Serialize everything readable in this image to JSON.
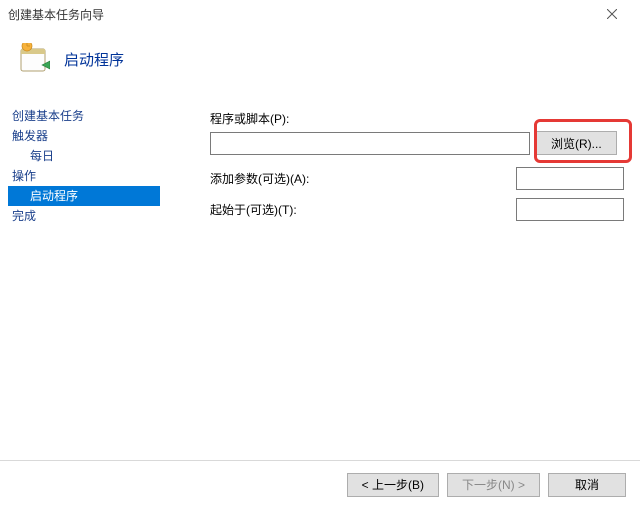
{
  "window": {
    "title": "创建基本任务向导"
  },
  "header": {
    "title": "启动程序"
  },
  "sidebar": {
    "items": [
      {
        "label": "创建基本任务",
        "sub": false,
        "selected": false
      },
      {
        "label": "触发器",
        "sub": false,
        "selected": false
      },
      {
        "label": "每日",
        "sub": true,
        "selected": false
      },
      {
        "label": "操作",
        "sub": false,
        "selected": false
      },
      {
        "label": "启动程序",
        "sub": true,
        "selected": true
      },
      {
        "label": "完成",
        "sub": false,
        "selected": false
      }
    ]
  },
  "form": {
    "script_label": "程序或脚本(P):",
    "script_value": "",
    "browse_label": "浏览(R)...",
    "args_label": "添加参数(可选)(A):",
    "args_value": "",
    "startin_label": "起始于(可选)(T):",
    "startin_value": ""
  },
  "footer": {
    "back": "< 上一步(B)",
    "next": "下一步(N) >",
    "cancel": "取消"
  }
}
